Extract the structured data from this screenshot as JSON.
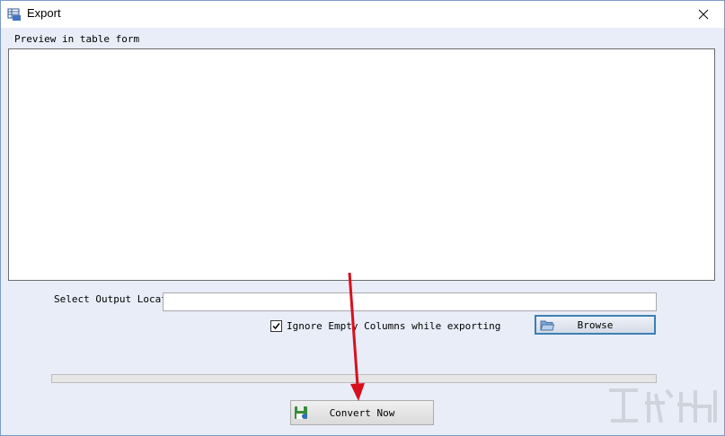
{
  "window": {
    "title": "Export",
    "icons": {
      "app": "table-app-icon",
      "close": "close-icon"
    }
  },
  "preview": {
    "label": "Preview in table form"
  },
  "output": {
    "label": "Select Output Locati",
    "value": "",
    "browse_label": "Browse",
    "browse_icon": "folder-icon"
  },
  "options": {
    "ignore_empty_columns": {
      "label": "Ignore Empty Columns while exporting",
      "checked": true
    }
  },
  "progress": {
    "value": 0
  },
  "actions": {
    "convert_label": "Convert Now",
    "convert_icon": "save-disk-icon"
  },
  "colors": {
    "accent": "#3c7fb1",
    "window_bg": "#e8edf8",
    "arrow": "#d8101e"
  }
}
